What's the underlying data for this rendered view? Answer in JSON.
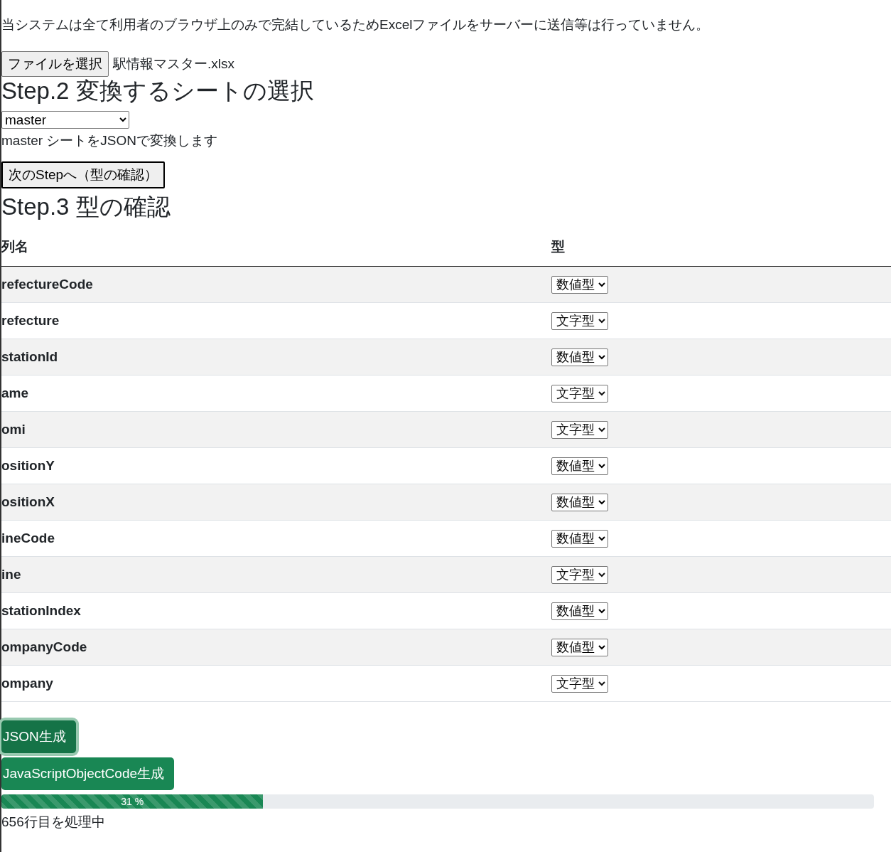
{
  "step1": {
    "description": "当システムは全て利用者のブラウザ上のみで完結しているためExcelファイルをサーバーに送信等は行っていません。",
    "file_button": "ファイルを選択",
    "file_name": "駅情報マスター.xlsx"
  },
  "step2": {
    "title": "Step.2 変換するシートの選択",
    "sheet": "master",
    "note": "master シートをJSONで変換します",
    "next_button": "次のStepへ（型の確認）"
  },
  "step3": {
    "title": "Step.3 型の確認",
    "columns": [
      "列名",
      "型"
    ],
    "rows": [
      {
        "name": "refectureCode",
        "type": "数値型"
      },
      {
        "name": "refecture",
        "type": "文字型"
      },
      {
        "name": "stationId",
        "type": "数値型"
      },
      {
        "name": "ame",
        "type": "文字型"
      },
      {
        "name": "omi",
        "type": "文字型"
      },
      {
        "name": "ositionY",
        "type": "数値型"
      },
      {
        "name": "ositionX",
        "type": "数値型"
      },
      {
        "name": "ineCode",
        "type": "数値型"
      },
      {
        "name": "ine",
        "type": "文字型"
      },
      {
        "name": "stationIndex",
        "type": "数値型"
      },
      {
        "name": "ompanyCode",
        "type": "数値型"
      },
      {
        "name": "ompany",
        "type": "文字型"
      }
    ]
  },
  "actions": [
    {
      "label": "JSON生成",
      "focused": true
    },
    {
      "label": "JavaScriptObjectCode生成",
      "focused": false
    }
  ],
  "progress": {
    "level": 0.3,
    "label": "31 %",
    "status": "656行目を処理中"
  }
}
